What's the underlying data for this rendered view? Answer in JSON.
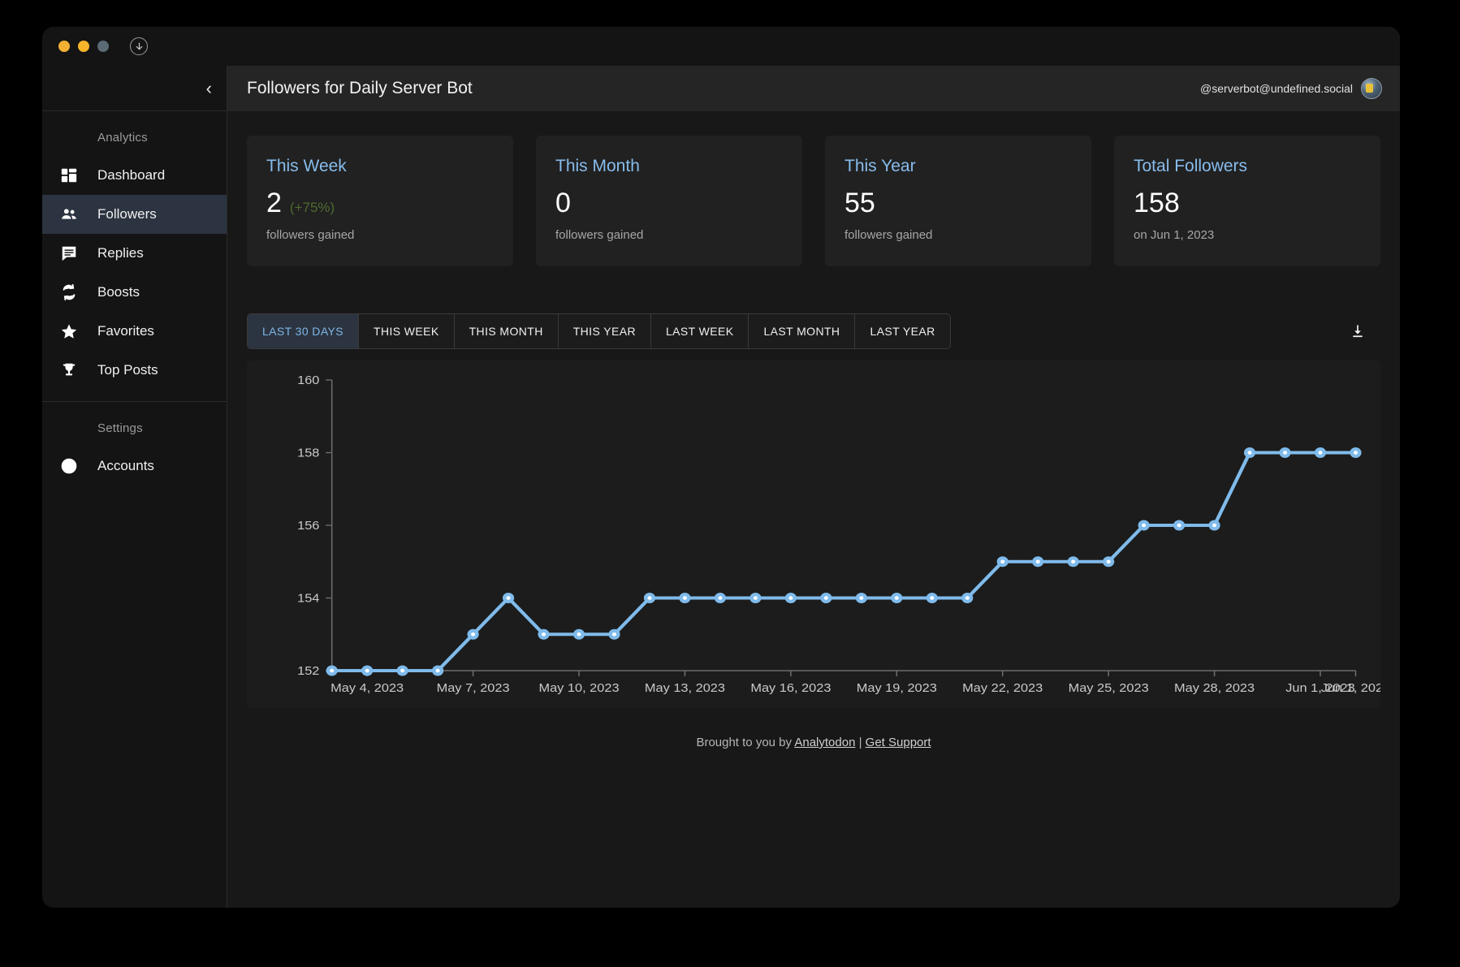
{
  "window": {
    "traffic_lights": [
      "close",
      "minimize",
      "zoom"
    ],
    "download_indicator_icon": "download-circle-icon"
  },
  "sidebar": {
    "collapse_icon": "chevron-left-icon",
    "sections": [
      {
        "label": "Analytics",
        "items": [
          {
            "label": "Dashboard",
            "icon": "dashboard-icon",
            "active": false
          },
          {
            "label": "Followers",
            "icon": "people-icon",
            "active": true
          },
          {
            "label": "Replies",
            "icon": "comment-icon",
            "active": false
          },
          {
            "label": "Boosts",
            "icon": "repeat-icon",
            "active": false
          },
          {
            "label": "Favorites",
            "icon": "star-icon",
            "active": false
          },
          {
            "label": "Top Posts",
            "icon": "trophy-icon",
            "active": false
          }
        ]
      },
      {
        "label": "Settings",
        "items": [
          {
            "label": "Accounts",
            "icon": "accounts-icon",
            "active": false
          }
        ]
      }
    ]
  },
  "header": {
    "title": "Followers for Daily Server Bot",
    "account_handle": "@serverbot@undefined.social",
    "avatar_icon": "user-avatar"
  },
  "cards": [
    {
      "title": "This Week",
      "value": "2",
      "delta": "(+75%)",
      "sub": "followers gained"
    },
    {
      "title": "This Month",
      "value": "0",
      "delta": "",
      "sub": "followers gained"
    },
    {
      "title": "This Year",
      "value": "55",
      "delta": "",
      "sub": "followers gained"
    },
    {
      "title": "Total Followers",
      "value": "158",
      "delta": "",
      "sub": "on Jun 1, 2023"
    }
  ],
  "range_tabs": {
    "items": [
      {
        "label": "LAST 30 DAYS",
        "active": true
      },
      {
        "label": "THIS WEEK",
        "active": false
      },
      {
        "label": "THIS MONTH",
        "active": false
      },
      {
        "label": "THIS YEAR",
        "active": false
      },
      {
        "label": "LAST WEEK",
        "active": false
      },
      {
        "label": "LAST MONTH",
        "active": false
      },
      {
        "label": "LAST YEAR",
        "active": false
      }
    ],
    "download_icon": "download-icon"
  },
  "chart_data": {
    "type": "line",
    "title": "",
    "xlabel": "",
    "ylabel": "",
    "ylim": [
      152,
      160
    ],
    "yticks": [
      152,
      154,
      156,
      158,
      160
    ],
    "grid": false,
    "legend": "none",
    "line_color": "#7fbbeb",
    "marker_color": "#7fbbeb",
    "marker_inner_color": "#ffffff",
    "x": [
      "May 3, 2023",
      "May 4, 2023",
      "May 5, 2023",
      "May 6, 2023",
      "May 7, 2023",
      "May 8, 2023",
      "May 9, 2023",
      "May 10, 2023",
      "May 11, 2023",
      "May 12, 2023",
      "May 13, 2023",
      "May 14, 2023",
      "May 15, 2023",
      "May 16, 2023",
      "May 17, 2023",
      "May 18, 2023",
      "May 19, 2023",
      "May 20, 2023",
      "May 21, 2023",
      "May 22, 2023",
      "May 23, 2023",
      "May 24, 2023",
      "May 25, 2023",
      "May 26, 2023",
      "May 27, 2023",
      "May 28, 2023",
      "May 29, 2023",
      "May 30, 2023",
      "May 31, 2023",
      "Jun 1, 2023"
    ],
    "xticklabels": [
      "May 4, 2023",
      "May 7, 2023",
      "May 10, 2023",
      "May 13, 2023",
      "May 16, 2023",
      "May 19, 2023",
      "May 22, 2023",
      "May 25, 2023",
      "May 28, 2023",
      "Jun 1, 2023"
    ],
    "values": [
      152,
      152,
      152,
      152,
      153,
      154,
      153,
      153,
      153,
      154,
      154,
      154,
      154,
      154,
      154,
      154,
      154,
      154,
      154,
      155,
      155,
      155,
      155,
      156,
      156,
      156,
      158,
      158,
      158,
      158
    ],
    "series": [
      {
        "name": "Followers",
        "values": [
          152,
          152,
          152,
          152,
          153,
          154,
          153,
          153,
          153,
          154,
          154,
          154,
          154,
          154,
          154,
          154,
          154,
          154,
          154,
          155,
          155,
          155,
          155,
          156,
          156,
          156,
          158,
          158,
          158,
          158
        ]
      }
    ]
  },
  "footer": {
    "prefix": "Brought to you by ",
    "brand": "Analytodon",
    "separator": " | ",
    "support": "Get Support"
  }
}
